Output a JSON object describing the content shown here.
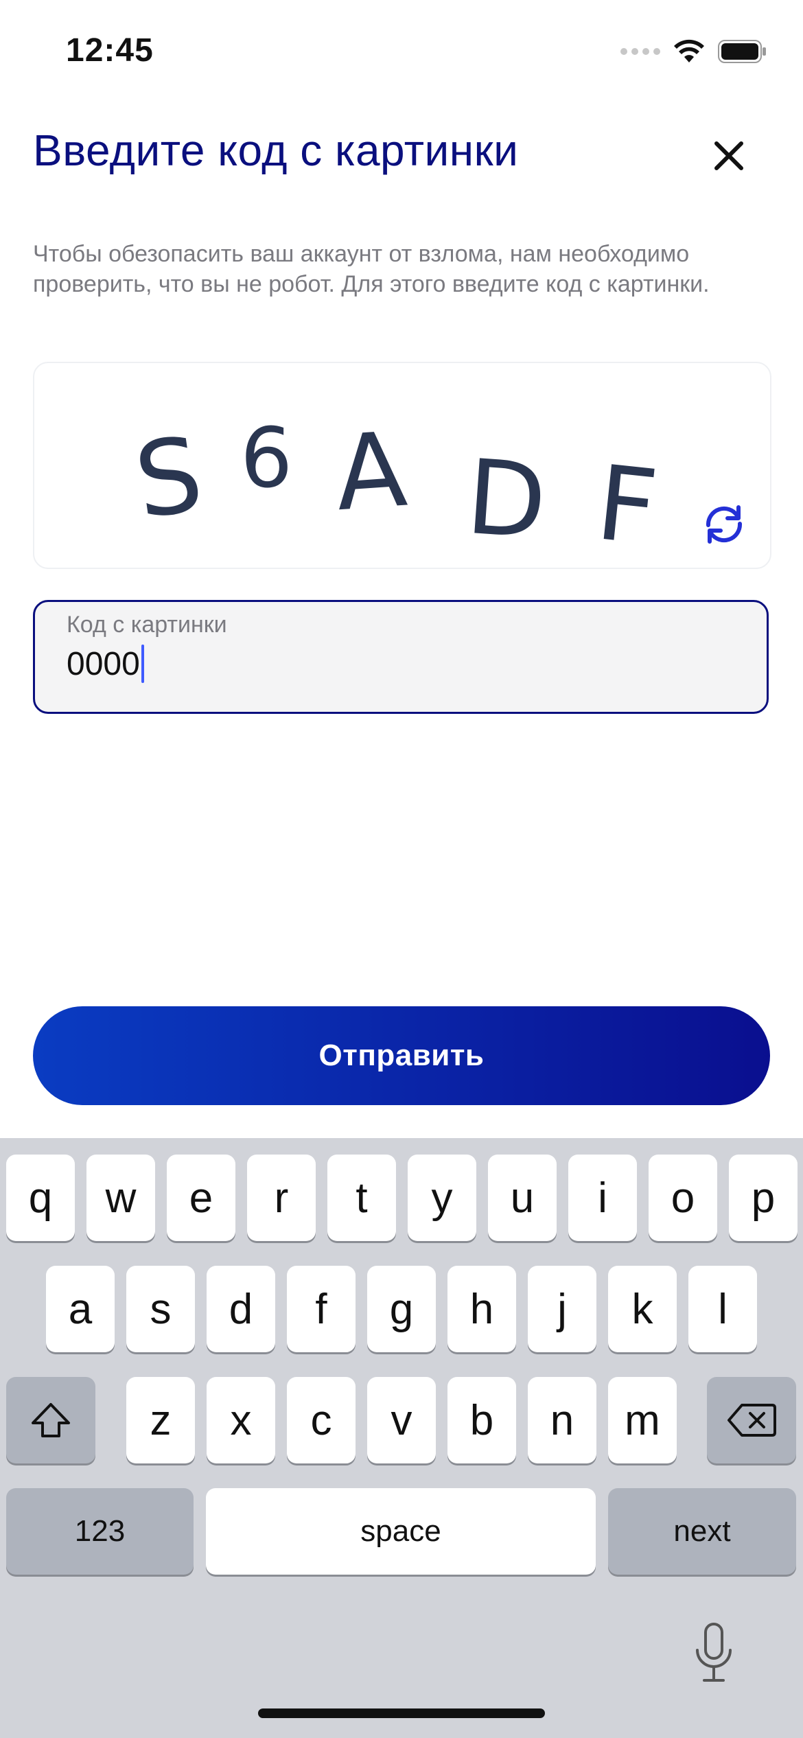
{
  "status_bar": {
    "time": "12:45"
  },
  "header": {
    "title": "Введите код с картинки"
  },
  "description": "Чтобы обезопасить ваш аккаунт от взлома, нам необходимо проверить, что вы не робот. Для этого введите код с картинки.",
  "captcha": {
    "text": "S6ADF"
  },
  "code_field": {
    "label": "Код с картинки",
    "value": "0000"
  },
  "submit": {
    "label": "Отправить"
  },
  "keyboard": {
    "row1": [
      "q",
      "w",
      "e",
      "r",
      "t",
      "y",
      "u",
      "i",
      "o",
      "p"
    ],
    "row2": [
      "a",
      "s",
      "d",
      "f",
      "g",
      "h",
      "j",
      "k",
      "l"
    ],
    "row3": [
      "z",
      "x",
      "c",
      "v",
      "b",
      "n",
      "m"
    ],
    "numbers_label": "123",
    "space_label": "space",
    "next_label": "next"
  },
  "colors": {
    "accent": "#0a0f7e",
    "button_start": "#0a3cc2",
    "button_end": "#0a0f8f",
    "keyboard_bg": "#d1d3d9"
  }
}
